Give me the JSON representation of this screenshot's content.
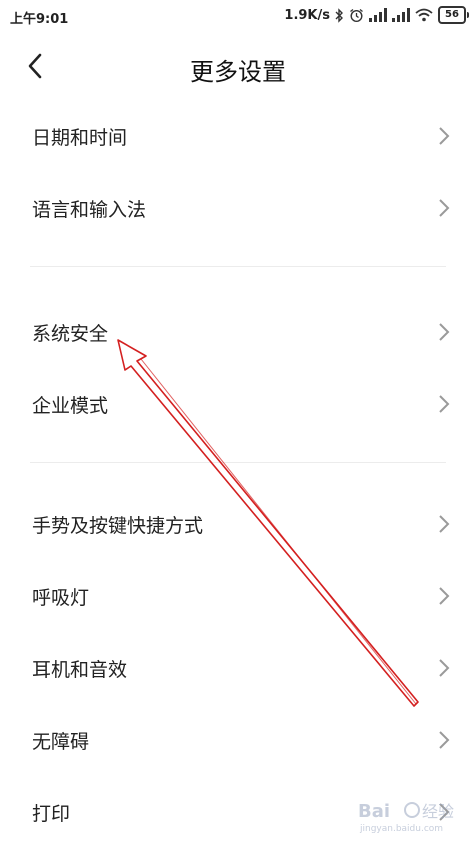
{
  "status_bar": {
    "time": "上午9:01",
    "network_speed": "1.9K/s",
    "battery_level": "56",
    "icons": [
      "bluetooth-icon",
      "alarm-icon",
      "signal-icon",
      "signal-icon",
      "wifi-icon",
      "battery-icon"
    ]
  },
  "header": {
    "title": "更多设置",
    "back_icon": "back-arrow-icon"
  },
  "settings": {
    "group1": [
      {
        "label": "日期和时间"
      },
      {
        "label": "语言和输入法"
      }
    ],
    "group2": [
      {
        "label": "系统安全"
      },
      {
        "label": "企业模式"
      }
    ],
    "group3": [
      {
        "label": "手势及按键快捷方式"
      },
      {
        "label": "呼吸灯"
      },
      {
        "label": "耳机和音效"
      },
      {
        "label": "无障碍"
      },
      {
        "label": "打印"
      }
    ]
  },
  "annotation": {
    "arrow_color": "#d42020",
    "points_to": "系统安全"
  },
  "colors": {
    "background": "#ffffff",
    "text": "#222222",
    "chevron": "#9a9a9a",
    "divider": "#ececec"
  }
}
